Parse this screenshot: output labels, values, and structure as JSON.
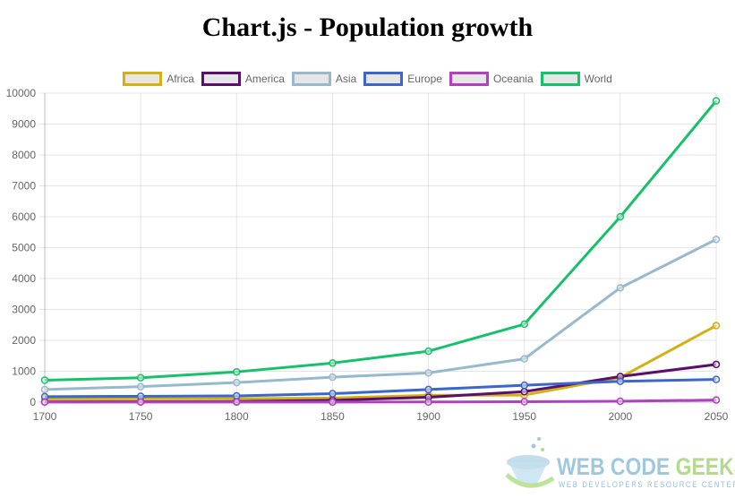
{
  "title": "Chart.js - Population growth",
  "watermark": {
    "brand_part1": "WEB CODE ",
    "brand_part2": "GEEKS",
    "tagline": "WEB DEVELOPERS RESOURCE CENTER"
  },
  "chart_data": {
    "type": "line",
    "title": "Chart.js - Population growth",
    "xlabel": "",
    "ylabel": "",
    "x": [
      "1700",
      "1750",
      "1800",
      "1850",
      "1900",
      "1950",
      "2000",
      "2050"
    ],
    "ylim": [
      0,
      10000
    ],
    "yticks": [
      "0",
      "1000",
      "2000",
      "3000",
      "4000",
      "5000",
      "6000",
      "7000",
      "8000",
      "9000",
      "10000"
    ],
    "grid": true,
    "legend": "top-center",
    "series": [
      {
        "name": "Africa",
        "color": "#d4b012",
        "values": [
          106,
          107,
          111,
          133,
          221,
          230,
          800,
          2478
        ]
      },
      {
        "name": "America",
        "color": "#5a0f6b",
        "values": [
          10,
          15,
          20,
          60,
          160,
          340,
          830,
          1220
        ]
      },
      {
        "name": "Asia",
        "color": "#98b9cc",
        "values": [
          411,
          502,
          635,
          809,
          947,
          1402,
          3700,
          5267
        ]
      },
      {
        "name": "Europe",
        "color": "#3a67c9",
        "values": [
          178,
          190,
          203,
          276,
          408,
          547,
          675,
          734
        ]
      },
      {
        "name": "Oceania",
        "color": "#b040bf",
        "values": [
          2,
          2,
          2,
          2,
          6,
          13,
          30,
          70
        ]
      },
      {
        "name": "World",
        "color": "#17c06a",
        "values": [
          710,
          791,
          980,
          1265,
          1650,
          2525,
          6000,
          9750
        ]
      }
    ]
  }
}
